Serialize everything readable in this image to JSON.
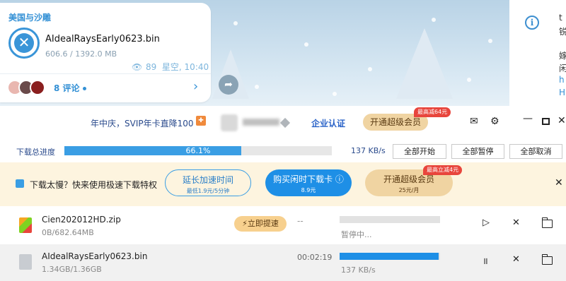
{
  "chat": {
    "sender": "美国与沙雕",
    "file_name": "AIdealRaysEarly0623.bin",
    "file_progress": "606.6 / 1392.0 MB",
    "views": "89",
    "author_time": "星空, 10:40",
    "comments": "8 评论",
    "right_panel_lines": [
      "t",
      "锐",
      "嫁",
      "闲",
      "h",
      "H"
    ]
  },
  "titlebar": {
    "promo": "年中庆，SVIP年卡直降100",
    "enterprise": "企业认证",
    "vip_button": "开通超级会员",
    "vip_tag": "最高减64元"
  },
  "progress": {
    "label": "下载总进度",
    "percent_text": "66.1%",
    "fraction": 0.661,
    "speed": "137 KB/s",
    "start_all": "全部开始",
    "pause_all": "全部暂停",
    "cancel_all": "全部取消"
  },
  "banner": {
    "text": "下载太慢？快来使用极速下载特权",
    "extend_title": "延长加速时间",
    "extend_sub": "最低1.9元/5分钟",
    "buy_title": "购买闲时下载卡",
    "buy_sub": "8.9元",
    "vip_title": "开通超级会员",
    "vip_sub": "25元/月",
    "vip_tag": "最高立减4元"
  },
  "downloads": [
    {
      "name": "Cien202012HD.zip",
      "size": "0B/682.64MB",
      "boost": "立即提速",
      "time": "--",
      "progress": 0,
      "status": "暂停中..."
    },
    {
      "name": "AIdealRaysEarly0623.bin",
      "size": "1.34GB/1.36GB",
      "time": "00:02:19",
      "progress": 0.985,
      "status": "137 KB/s"
    }
  ]
}
